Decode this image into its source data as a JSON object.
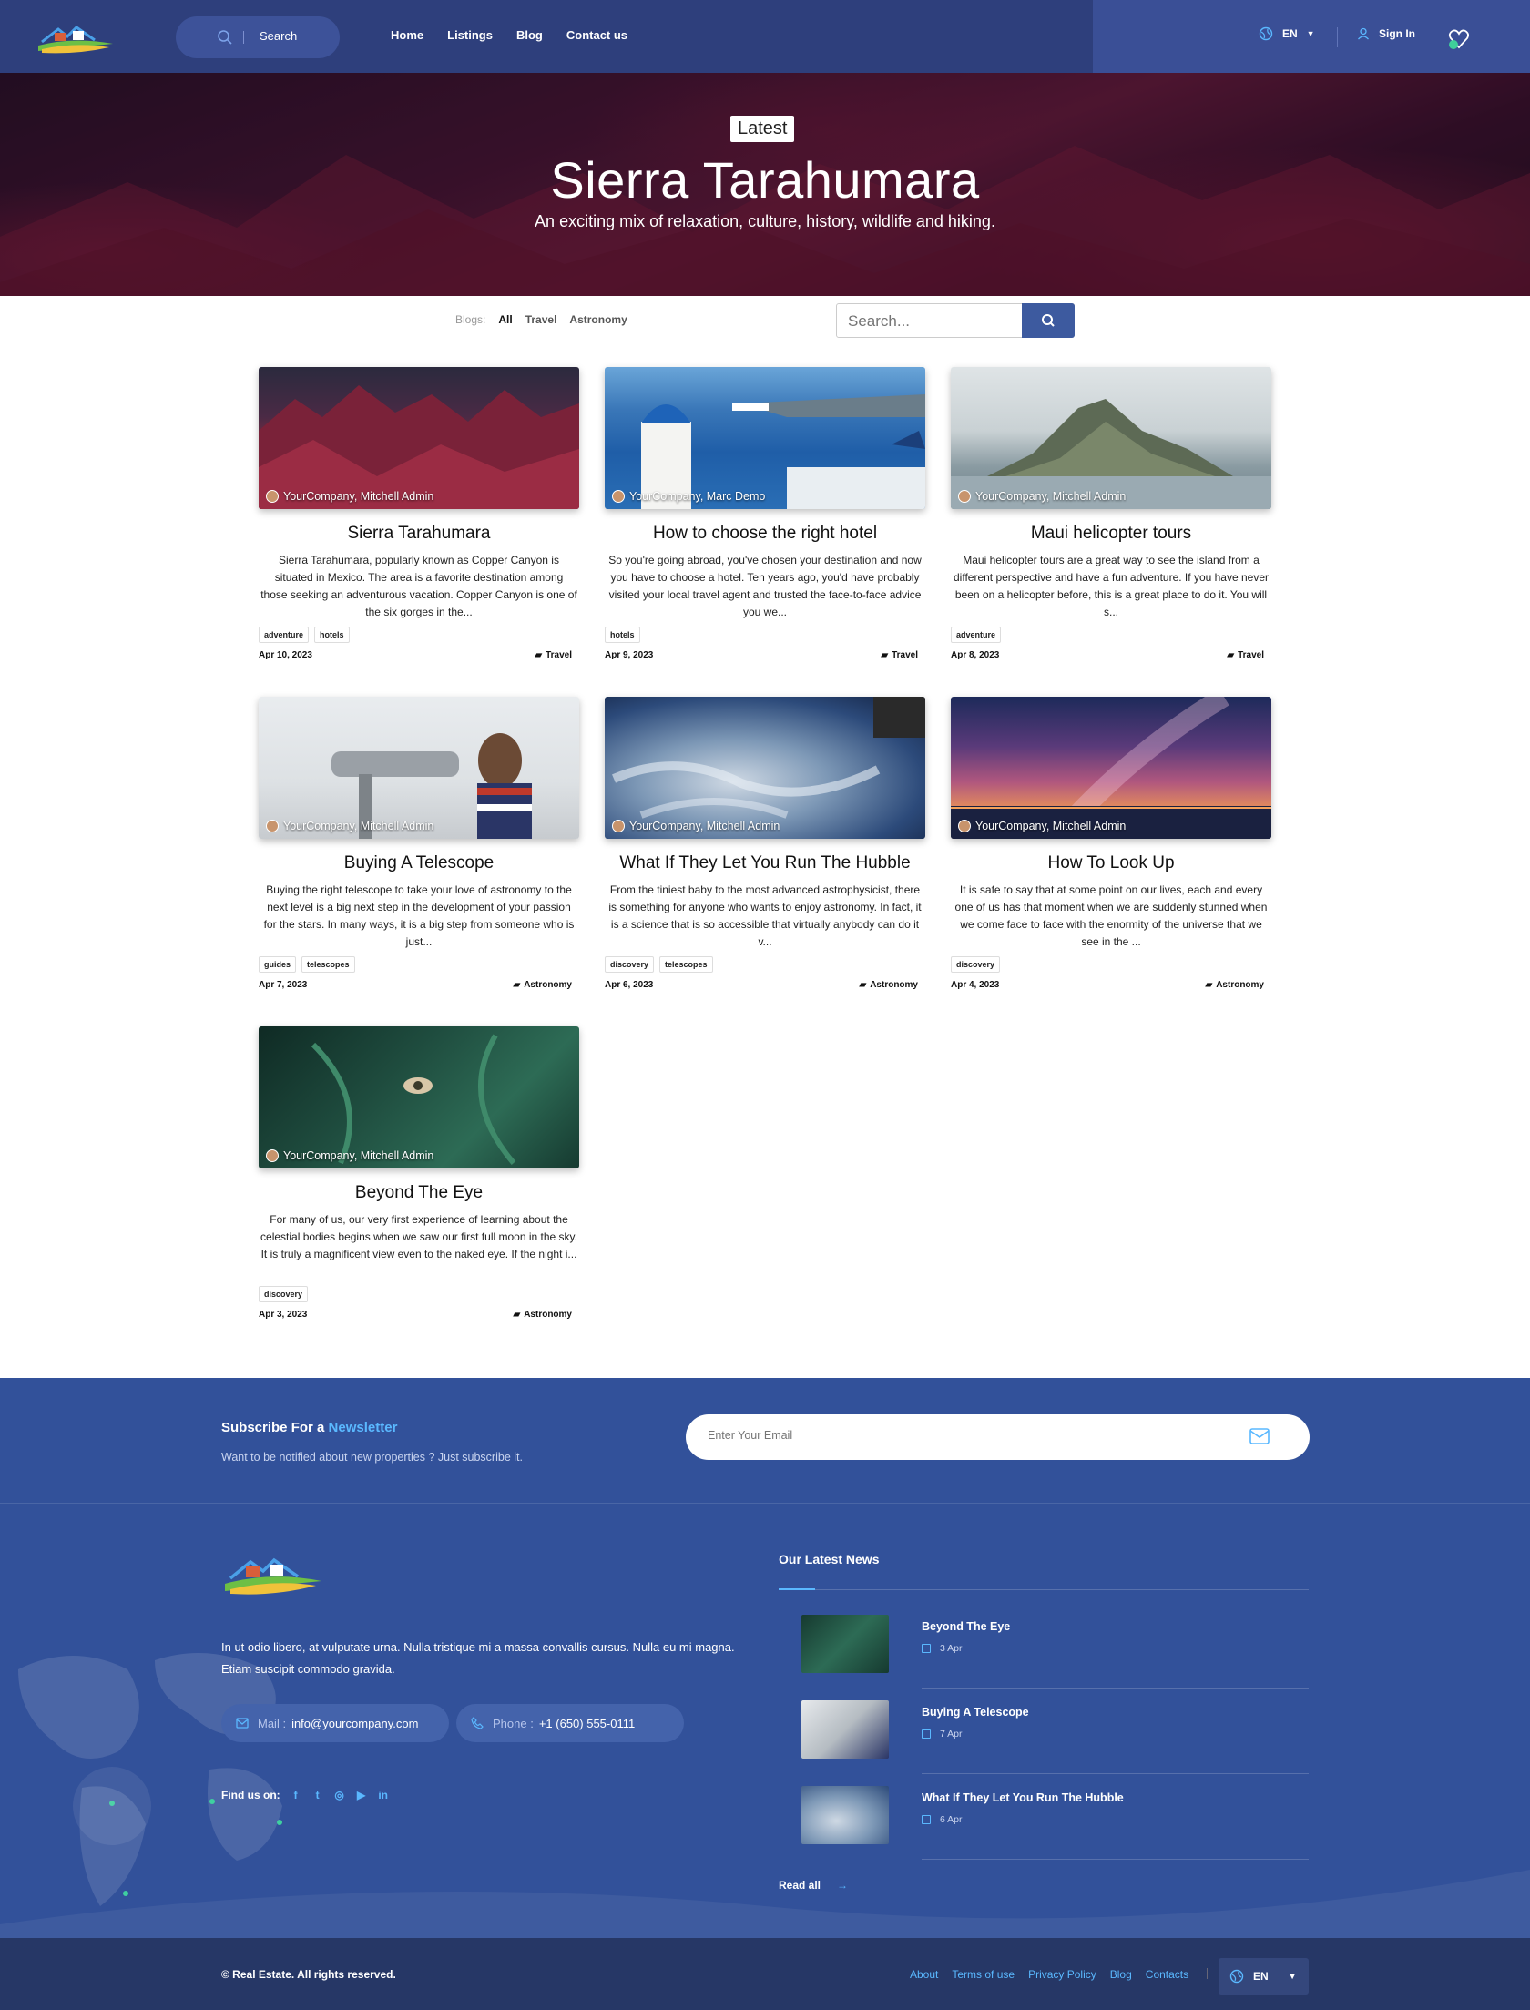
{
  "header": {
    "search_label": "Search",
    "nav": [
      "Home",
      "Listings",
      "Blog",
      "Contact us"
    ],
    "lang": "EN",
    "signin": "Sign In"
  },
  "hero": {
    "badge": "Latest",
    "title": "Sierra Tarahumara",
    "subtitle": "An exciting mix of relaxation, culture, history, wildlife and hiking."
  },
  "filters": {
    "label": "Blogs:",
    "items": [
      "All",
      "Travel",
      "Astronomy"
    ],
    "search_placeholder": "Search..."
  },
  "posts": [
    {
      "author": "YourCompany, Mitchell Admin",
      "title": "Sierra Tarahumara",
      "desc": "Sierra Tarahumara, popularly known as Copper Canyon is situated in Mexico. The area is a favorite destination among those seeking an adventurous vacation. Copper Canyon is one of the six gorges in the...",
      "tags": [
        "adventure",
        "hotels"
      ],
      "date": "Apr 10, 2023",
      "category": "Travel"
    },
    {
      "author": "YourCompany, Marc Demo",
      "title": "How to choose the right hotel",
      "desc": "So you're going abroad, you've chosen your destination and now you have to choose a hotel. Ten years ago, you'd have probably visited your local travel agent and trusted the face-to-face advice you we...",
      "tags": [
        "hotels"
      ],
      "date": "Apr 9, 2023",
      "category": "Travel"
    },
    {
      "author": "YourCompany, Mitchell Admin",
      "title": "Maui helicopter tours",
      "desc": "Maui helicopter tours are a great way to see the island from a different perspective and have a fun adventure. If you have never been on a helicopter before, this is a great place to do it. You will s...",
      "tags": [
        "adventure"
      ],
      "date": "Apr 8, 2023",
      "category": "Travel"
    },
    {
      "author": "YourCompany, Mitchell Admin",
      "title": "Buying A Telescope",
      "desc": "Buying the right telescope to take your love of astronomy to the next level is a big next step in the development of your passion for the stars. In many ways, it is a big step from someone who is just...",
      "tags": [
        "guides",
        "telescopes"
      ],
      "date": "Apr 7, 2023",
      "category": "Astronomy"
    },
    {
      "author": "YourCompany, Mitchell Admin",
      "title": "What If They Let You Run The Hubble",
      "desc": "From the tiniest baby to the most advanced astrophysicist, there is something for anyone who wants to enjoy astronomy. In fact, it is a science that is so accessible that virtually anybody can do it v...",
      "tags": [
        "discovery",
        "telescopes"
      ],
      "date": "Apr 6, 2023",
      "category": "Astronomy"
    },
    {
      "author": "YourCompany, Mitchell Admin",
      "title": "How To Look Up",
      "desc": "It is safe to say that at some point on our lives, each and every one of us has that moment when we are suddenly stunned when we come face to face with the enormity of the universe that we see in the ...",
      "tags": [
        "discovery"
      ],
      "date": "Apr 4, 2023",
      "category": "Astronomy"
    },
    {
      "author": "YourCompany, Mitchell Admin",
      "title": "Beyond The Eye",
      "desc": "For many of us, our very first experience of learning about the celestial bodies begins when we saw our first full moon in the sky. It is truly a magnificent view even to the naked eye. If the night i...",
      "tags": [
        "discovery"
      ],
      "date": "Apr 3, 2023",
      "category": "Astronomy"
    }
  ],
  "newsletter": {
    "title_prefix": "Subscribe For a ",
    "title_highlight": "Newsletter",
    "subtitle": "Want to be notified about new properties ? Just subscribe it.",
    "placeholder": "Enter Your Email"
  },
  "footer": {
    "text": "In ut odio libero, at vulputate urna. Nulla tristique mi a massa convallis cursus. Nulla eu mi magna. Etiam suscipit commodo gravida.",
    "mail_label": "Mail :",
    "mail": "info@yourcompany.com",
    "phone_label": "Phone :",
    "phone": "+1 (650) 555-0111",
    "find_us": "Find us on:",
    "news_title": "Our Latest News",
    "news": [
      {
        "title": "Beyond The Eye",
        "date": "3 Apr"
      },
      {
        "title": "Buying A Telescope",
        "date": "7 Apr"
      },
      {
        "title": "What If They Let You Run The Hubble",
        "date": "6 Apr"
      }
    ],
    "read_all": "Read all",
    "read_all_arrow": "→"
  },
  "bottom": {
    "copyright": "© Real Estate. All rights reserved.",
    "links": [
      "About",
      "Terms of use",
      "Privacy Policy",
      "Blog",
      "Contacts"
    ],
    "lang": "EN"
  },
  "colors": {
    "header_bg": "#2e3f7c",
    "footer_bg": "#32519a",
    "accent": "#5ab8ff",
    "bottom_bg": "#263766"
  }
}
